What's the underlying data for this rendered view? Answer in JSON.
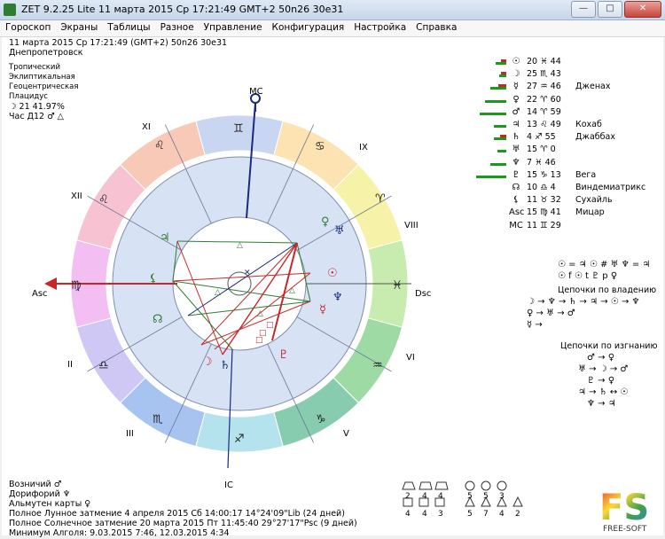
{
  "window": {
    "title": "ZET 9.2.25 Lite   11 марта 2015  Ср  17:21:49 GMT+2 50n26  30e31"
  },
  "menu": [
    "Гороскоп",
    "Экраны",
    "Таблицы",
    "Разное",
    "Управление",
    "Конфигурация",
    "Настройка",
    "Справка"
  ],
  "header": {
    "line1": "11 марта 2015  Ср  17:21:49 (GMT+2) 50n26  30e31",
    "city": "Днепропетровск",
    "opts": [
      "Тропический",
      "Эклиптикальная",
      "Геоцентрическая",
      "Плацидус"
    ],
    "moon": "☽ 21 41.97%",
    "hour": "Час Д12 ♂ △"
  },
  "chart": {
    "axes": {
      "mc": "MC",
      "ic": "IC",
      "asc": "Asc",
      "dsc": "Dsc"
    },
    "houses": [
      "XI",
      "IX",
      "XII",
      "VIII",
      "II",
      "VI",
      "III",
      "V"
    ],
    "signs": [
      "♊",
      "♋",
      "♌",
      "♍",
      "♎",
      "♏",
      "♐",
      "♑",
      "♒",
      "♓",
      "♈",
      "♉"
    ],
    "planet_glyphs": [
      "♀",
      "♅",
      "☉",
      "♆",
      "☿",
      "♃",
      "♄",
      "☽",
      "♇",
      "☊",
      "♂",
      "⚸"
    ]
  },
  "planets": [
    {
      "sym": "☉",
      "pos": "20 ♓ 44",
      "star": "",
      "bar": 12,
      "red": true
    },
    {
      "sym": "☽",
      "pos": "25 ♏ 43",
      "star": "",
      "bar": 8,
      "red": true
    },
    {
      "sym": "☿",
      "pos": "27 ♒ 46",
      "star": "Дженах",
      "bar": 18,
      "red": true
    },
    {
      "sym": "♀",
      "pos": "22 ♈ 60",
      "star": "",
      "bar": 24,
      "red": false
    },
    {
      "sym": "♂",
      "pos": "14 ♈ 59",
      "star": "",
      "bar": 30,
      "red": false
    },
    {
      "sym": "♃",
      "pos": "13 ♌ 49",
      "star": "Кохаб",
      "bar": 14,
      "red": false
    },
    {
      "sym": "♄",
      "pos": "4 ♐ 55",
      "star": "Джаббах",
      "bar": 14,
      "red": true
    },
    {
      "sym": "♅",
      "pos": "15 ♈ 0",
      "star": "",
      "bar": 10,
      "red": false
    },
    {
      "sym": "♆",
      "pos": "7 ♓ 46",
      "star": "",
      "bar": 18,
      "red": false
    },
    {
      "sym": "♇",
      "pos": "15 ♑ 13",
      "star": "Вега",
      "bar": 34,
      "red": false
    },
    {
      "sym": "☊",
      "pos": "10 ♎ 4",
      "star": "Виндемиатрикс",
      "bar": 0,
      "red": false
    },
    {
      "sym": "⚸",
      "pos": "11 ♉ 32",
      "star": "Сухайль",
      "bar": 0,
      "red": false
    },
    {
      "sym": "Asc",
      "pos": "15 ♍ 41",
      "star": "Мицар",
      "bar": 0,
      "red": false
    },
    {
      "sym": "MC",
      "pos": "11 ♊ 29",
      "star": "",
      "bar": 0,
      "red": false
    }
  ],
  "right": {
    "receptions1": "☉ = ♃  ☉ # ♅  ♆ = ♃",
    "receptions2": "☉ f ☉ t ♇ p ♀",
    "chains_rule_title": "Цепочки по владению",
    "chain_r1": "☽ → ♆ → ♄ → ♃ → ☉ → ♆",
    "chain_r2": "♀ → ♅ → ♂",
    "chain_r3": "☿ →",
    "chains_fall_title": "Цепочки по изгнанию",
    "chain_f1": "♂ → ♀",
    "chain_f2": "♅ → ☽ → ♂",
    "chain_f3": "♇ → ♀",
    "chain_f4": "♃ → ♄ ↔ ☉",
    "chain_f5": "♆ → ♃"
  },
  "footer": {
    "l1": "Возничий  ♂",
    "l2": "Дорифорий  ♆",
    "l3": "Альмутен карты  ♀",
    "l4": "Полное Лунное затмение 4 апреля 2015 Сб 14:00:17 14°24'09\"Lib (24 дней)",
    "l5": "Полное Солнечное затмение 20 марта 2015 Пт 11:45:40 29°27'17\"Psc (9 дней)",
    "l6": "Минимум Алголя: 9.03.2015  7:46,  12.03.2015  4:34"
  },
  "counts": {
    "shapes_a": [
      "2",
      "4",
      "4",
      "4",
      "4",
      "3",
      "3"
    ],
    "shapes_b": [
      "5",
      "5",
      "3",
      "5",
      "7",
      "4",
      "2"
    ]
  },
  "logo": {
    "top": "FS",
    "bottom": "FREE-SOFT"
  },
  "colors": {
    "green": "#1a9a1a",
    "red": "#c62828",
    "navy": "#1a2a80",
    "asc_arrow": "#c62828"
  }
}
